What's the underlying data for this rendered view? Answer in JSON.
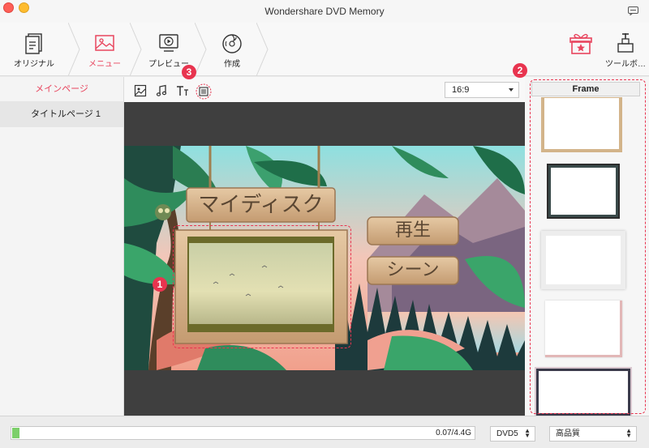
{
  "window": {
    "title": "Wondershare DVD Memory"
  },
  "toolbar": {
    "steps": [
      {
        "label": "オリジナル",
        "icon": "document-icon"
      },
      {
        "label": "メニュー",
        "icon": "image-icon",
        "active": true
      },
      {
        "label": "プレビュー",
        "icon": "play-monitor-icon"
      },
      {
        "label": "作成",
        "icon": "disc-burn-icon"
      }
    ],
    "tools_label": "ツールボ…"
  },
  "left_panel": {
    "main_page": "メインページ",
    "title_page": "タイトルページ 1"
  },
  "editor_tools": {
    "aspect_ratio": "16:9"
  },
  "menu_preview": {
    "title": "マイディスク",
    "play_button": "再生",
    "scene_button": "シーン"
  },
  "frame_panel": {
    "header": "Frame"
  },
  "badges": {
    "one": "1",
    "two": "2",
    "three": "3"
  },
  "bottom": {
    "capacity": "0.07/4.4G",
    "progress_fraction": 0.016,
    "disc_type": "DVD5",
    "quality": "高品質"
  },
  "colors": {
    "accent": "#e8455e",
    "badge": "#e8344f",
    "progress": "#7ccf6a"
  }
}
